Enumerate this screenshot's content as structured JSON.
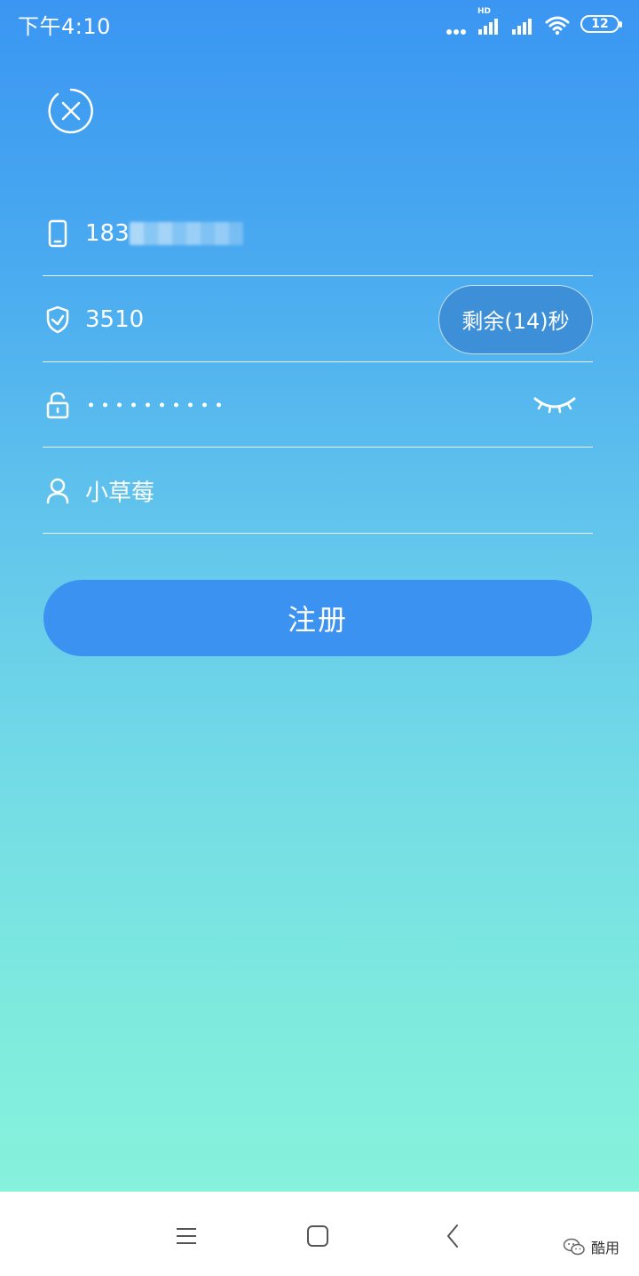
{
  "status_bar": {
    "time": "下午4:10",
    "hd_label": "HD",
    "battery_level": "12",
    "icons": [
      "dots-icon",
      "signal-hd-icon",
      "signal-icon",
      "wifi-icon",
      "battery-icon"
    ]
  },
  "close_icon": "close-circle-icon",
  "form": {
    "phone": {
      "icon": "phone-icon",
      "value_visible": "183"
    },
    "code": {
      "icon": "shield-icon",
      "value": "3510",
      "countdown_label": "剩余(14)秒"
    },
    "password": {
      "icon": "lock-icon",
      "dots": 10,
      "toggle_icon": "eye-closed-icon"
    },
    "nickname": {
      "icon": "user-icon",
      "value": "小草莓"
    }
  },
  "register_label": "注册",
  "nav": {
    "icons": [
      "menu-icon",
      "home-icon",
      "back-icon"
    ]
  },
  "watermark": {
    "icon": "wechat-icon",
    "text": "酷用"
  },
  "colors": {
    "gradient_top": "#3a96f2",
    "gradient_bottom": "#86f2dc",
    "button": "#3b92f0",
    "countdown_button": "#3d8fd8"
  }
}
